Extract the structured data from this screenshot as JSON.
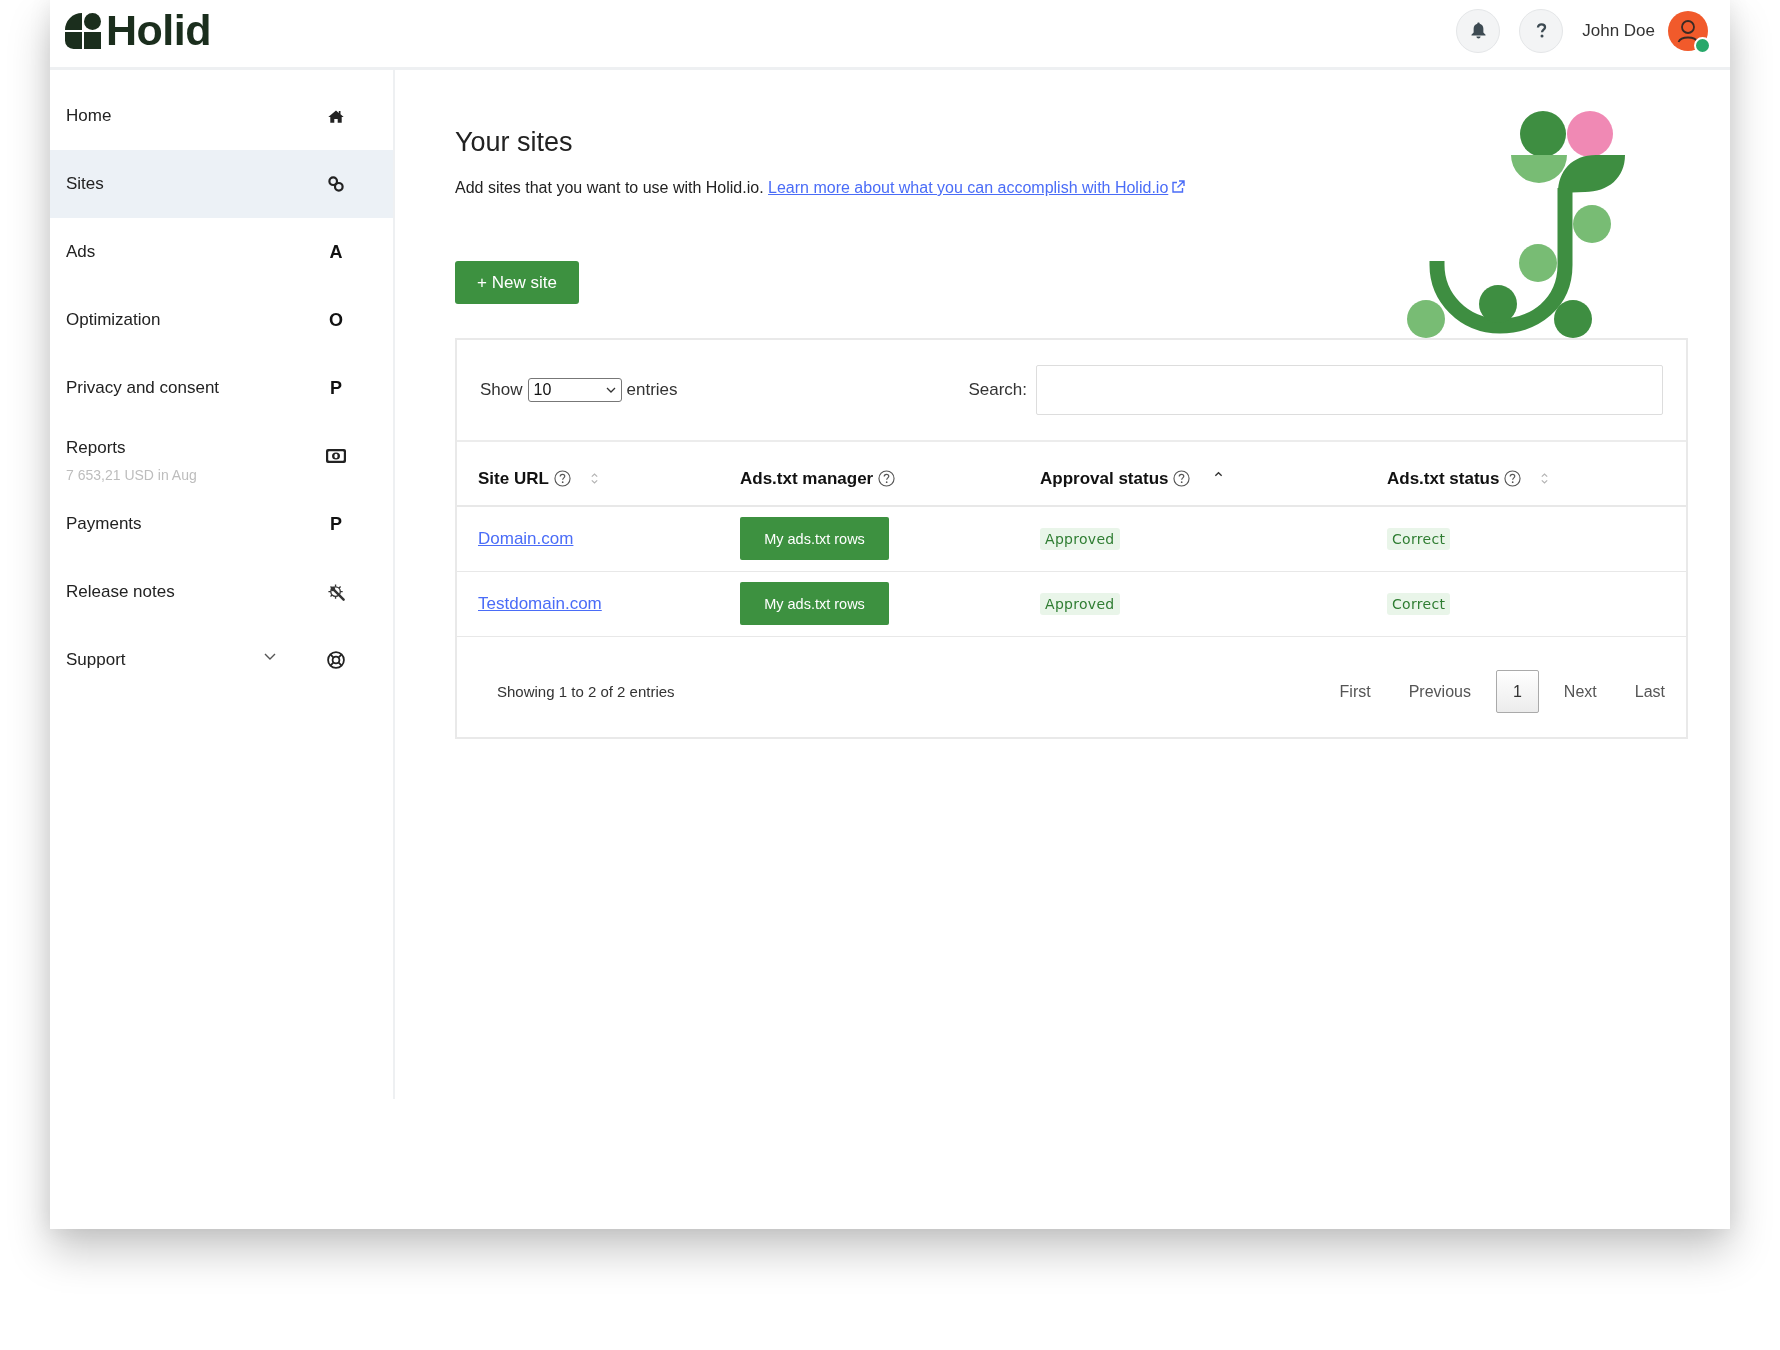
{
  "header": {
    "logo": "Holid",
    "user": {
      "name": "John Doe",
      "online": true
    }
  },
  "sidebar": {
    "items": [
      {
        "kind": "icon",
        "label": "Home",
        "selected": false
      },
      {
        "kind": "icon",
        "label": "Sites",
        "selected": true
      },
      {
        "kind": "letter",
        "label": "Ads",
        "glyph": "A",
        "selected": false
      },
      {
        "kind": "letter",
        "label": "Optimization",
        "glyph": "O",
        "selected": false
      },
      {
        "kind": "letter",
        "label": "Privacy and consent",
        "glyph": "P",
        "selected": false
      },
      {
        "kind": "icon",
        "label": "Reports",
        "note": "7 653,21 USD in Aug",
        "selected": false
      },
      {
        "kind": "letter",
        "label": "Payments",
        "glyph": "P",
        "selected": false
      },
      {
        "kind": "icon",
        "label": "Release notes",
        "selected": false
      },
      {
        "kind": "icon",
        "label": "Support",
        "expanded": false,
        "selected": false
      }
    ]
  },
  "main": {
    "title": "Your sites",
    "intro": "Add sites that you want to use with Holid.io.",
    "intro_link": "Learn more about what you can accomplish with Holid.io",
    "new_site_button": "+ New site",
    "table": {
      "length_menu": {
        "label": "Show",
        "value": "10",
        "suffix": "entries"
      },
      "search": {
        "label": "Search:"
      },
      "columns": [
        {
          "label": "Site URL",
          "help": true,
          "sortable": true,
          "sorted": false
        },
        {
          "label": "Ads.txt manager",
          "help": true,
          "sortable": false
        },
        {
          "label": "Approval status",
          "help": true,
          "sortable": true,
          "sorted": true
        },
        {
          "label": "Ads.txt status",
          "help": true,
          "sortable": true,
          "sorted": false
        }
      ],
      "rows": [
        {
          "site_url": "Domain.com",
          "manager_button": "My ads.txt rows",
          "approval_status": "Approved",
          "ads_txt_status": "Correct"
        },
        {
          "site_url": "Testdomain.com",
          "manager_button": "My ads.txt rows",
          "approval_status": "Approved",
          "ads_txt_status": "Correct"
        }
      ],
      "info": "Showing 1 to 2 of 2 entries",
      "pagination": [
        {
          "label": "First",
          "selected": false
        },
        {
          "label": "Previous",
          "selected": false
        },
        {
          "label": "1",
          "selected": true
        },
        {
          "label": "Next",
          "selected": false
        },
        {
          "label": "Last",
          "selected": false
        }
      ]
    }
  }
}
